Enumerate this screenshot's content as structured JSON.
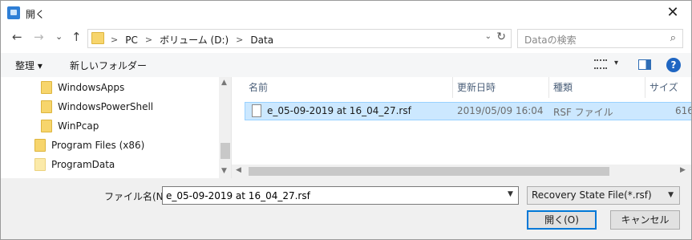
{
  "window": {
    "title": "開く",
    "close_label": "✕"
  },
  "nav": {
    "back": "←",
    "forward": "→",
    "recent": "⌄",
    "up": "↑",
    "breadcrumbs": [
      "PC",
      "ボリューム (D:)",
      "Data"
    ],
    "separator": ">",
    "dropdown": "⌄",
    "refresh": "↻",
    "search_placeholder": "Dataの検索"
  },
  "toolbar": {
    "organize": "整理 ▾",
    "new_folder": "新しいフォルダー",
    "view_dropdown": "▾",
    "help": "?"
  },
  "tree": [
    {
      "label": "WindowsApps",
      "style": "dark"
    },
    {
      "label": "WindowsPowerShell",
      "style": "dark"
    },
    {
      "label": "WinPcap",
      "style": "dark"
    },
    {
      "label": "Program Files (x86)",
      "style": "dark"
    },
    {
      "label": "ProgramData",
      "style": "light"
    }
  ],
  "columns": {
    "name": "名前",
    "modified": "更新日時",
    "type": "種類",
    "size": "サイズ"
  },
  "sort_arrow": "^",
  "files": [
    {
      "name": "e_05-09-2019 at 16_04_27.rsf",
      "modified": "2019/05/09 16:04",
      "type": "RSF ファイル",
      "size": "616"
    }
  ],
  "footer": {
    "filename_label": "ファイル名(N):",
    "filename_value": "e_05-09-2019 at 16_04_27.rsf",
    "filter": "Recovery State File(*.rsf)",
    "open_label": "開く(O)",
    "cancel_label": "キャンセル"
  },
  "colors": {
    "accent": "#0078d7",
    "selection": "#cce8ff",
    "folder": "#f7d56c"
  }
}
